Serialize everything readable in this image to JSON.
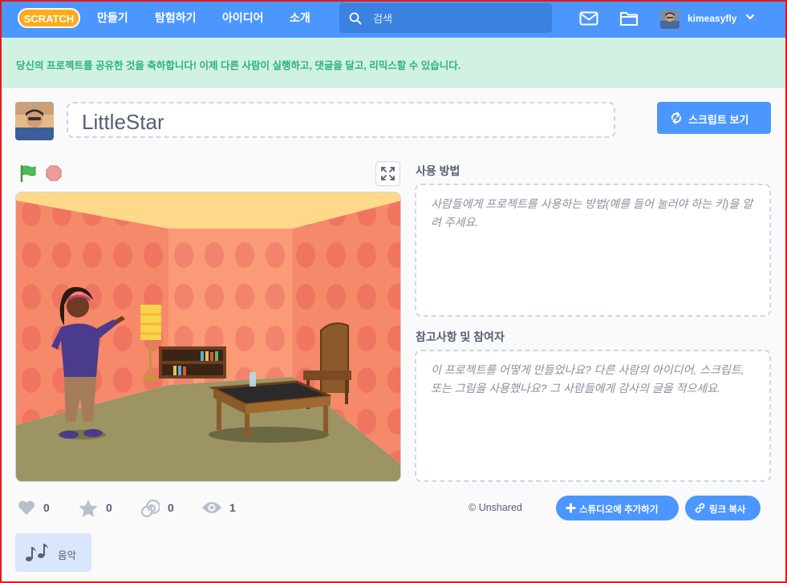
{
  "nav": {
    "logo_text": "SCRATCH",
    "items": [
      "만들기",
      "탐험하기",
      "아이디어",
      "소개"
    ],
    "search_placeholder": "검색",
    "username": "kimeasyfly"
  },
  "banner": {
    "message": "당신의 프로젝트를 공유한 것을 축하합니다! 이제 다른 사람이 실행하고, 댓글을 달고, 리믹스할 수 있습니다."
  },
  "project": {
    "title": "LittleStar",
    "see_inside_label": "스크립트 보기"
  },
  "instructions": {
    "label": "사용 방법",
    "placeholder": "사람들에게 프로젝트를 사용하는 방법(예를 들어 눌러야 하는 키)을 알려 주세요."
  },
  "notes": {
    "label": "참고사항 및 참여자",
    "placeholder": "이 프로젝트를 어떻게 만들었나요? 다른 사람의 아이디어, 스크립트, 또는 그림을 사용했나요? 그 사람들에게 감사의 글을 적으세요."
  },
  "stats": {
    "loves": "0",
    "favorites": "0",
    "remixes": "0",
    "views": "1"
  },
  "share_status": "Unshared",
  "actions": {
    "add_to_studio": "스튜디오에 추가하기",
    "copy_link": "링크 복사"
  },
  "tag": {
    "label": "음악"
  },
  "colors": {
    "nav_blue": "#4c97ff",
    "banner_green": "#d1f1e3",
    "banner_text": "#2cb37c",
    "text_gray": "#575e75"
  }
}
